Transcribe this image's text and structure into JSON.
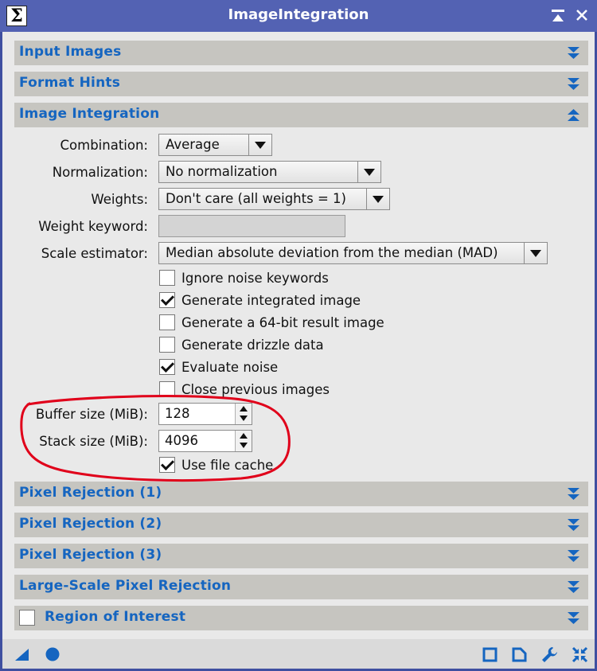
{
  "window": {
    "title": "ImageIntegration",
    "app_icon": "sigma-icon",
    "app_icon_glyph": "Σ"
  },
  "sections": {
    "input_images": "Input Images",
    "format_hints": "Format Hints",
    "image_integration": "Image Integration",
    "pixel_rejection_1": "Pixel Rejection (1)",
    "pixel_rejection_2": "Pixel Rejection (2)",
    "pixel_rejection_3": "Pixel Rejection (3)",
    "large_scale": "Large-Scale Pixel Rejection",
    "roi": "Region of Interest"
  },
  "fields": {
    "combination_label": "Combination:",
    "combination_value": "Average",
    "normalization_label": "Normalization:",
    "normalization_value": "No normalization",
    "weights_label": "Weights:",
    "weights_value": "Don't care (all weights = 1)",
    "weight_keyword_label": "Weight keyword:",
    "weight_keyword_value": "",
    "scale_estimator_label": "Scale estimator:",
    "scale_estimator_value": "Median absolute deviation from the median (MAD)"
  },
  "checkboxes": [
    {
      "label": "Ignore noise keywords",
      "checked": false
    },
    {
      "label": "Generate integrated image",
      "checked": true
    },
    {
      "label": "Generate a 64-bit result image",
      "checked": false
    },
    {
      "label": "Generate drizzle data",
      "checked": false
    },
    {
      "label": "Evaluate noise",
      "checked": true
    },
    {
      "label": "Close previous images",
      "checked": false
    }
  ],
  "buffer": {
    "label": "Buffer size (MiB):",
    "value": "128"
  },
  "stack": {
    "label": "Stack size (MiB):",
    "value": "4096"
  },
  "file_cache": {
    "label": "Use file cache",
    "checked": true
  },
  "colors": {
    "titlebar": "#5362b3",
    "section_bg": "#c6c5c0",
    "section_text": "#1565c0",
    "icon_blue": "#1565c0",
    "annotation_red": "#e0001a"
  },
  "bottom_icons": [
    "new-instance-icon",
    "apply-global-icon",
    "preview-icon",
    "document-icon",
    "wrench-icon",
    "reset-icon"
  ]
}
